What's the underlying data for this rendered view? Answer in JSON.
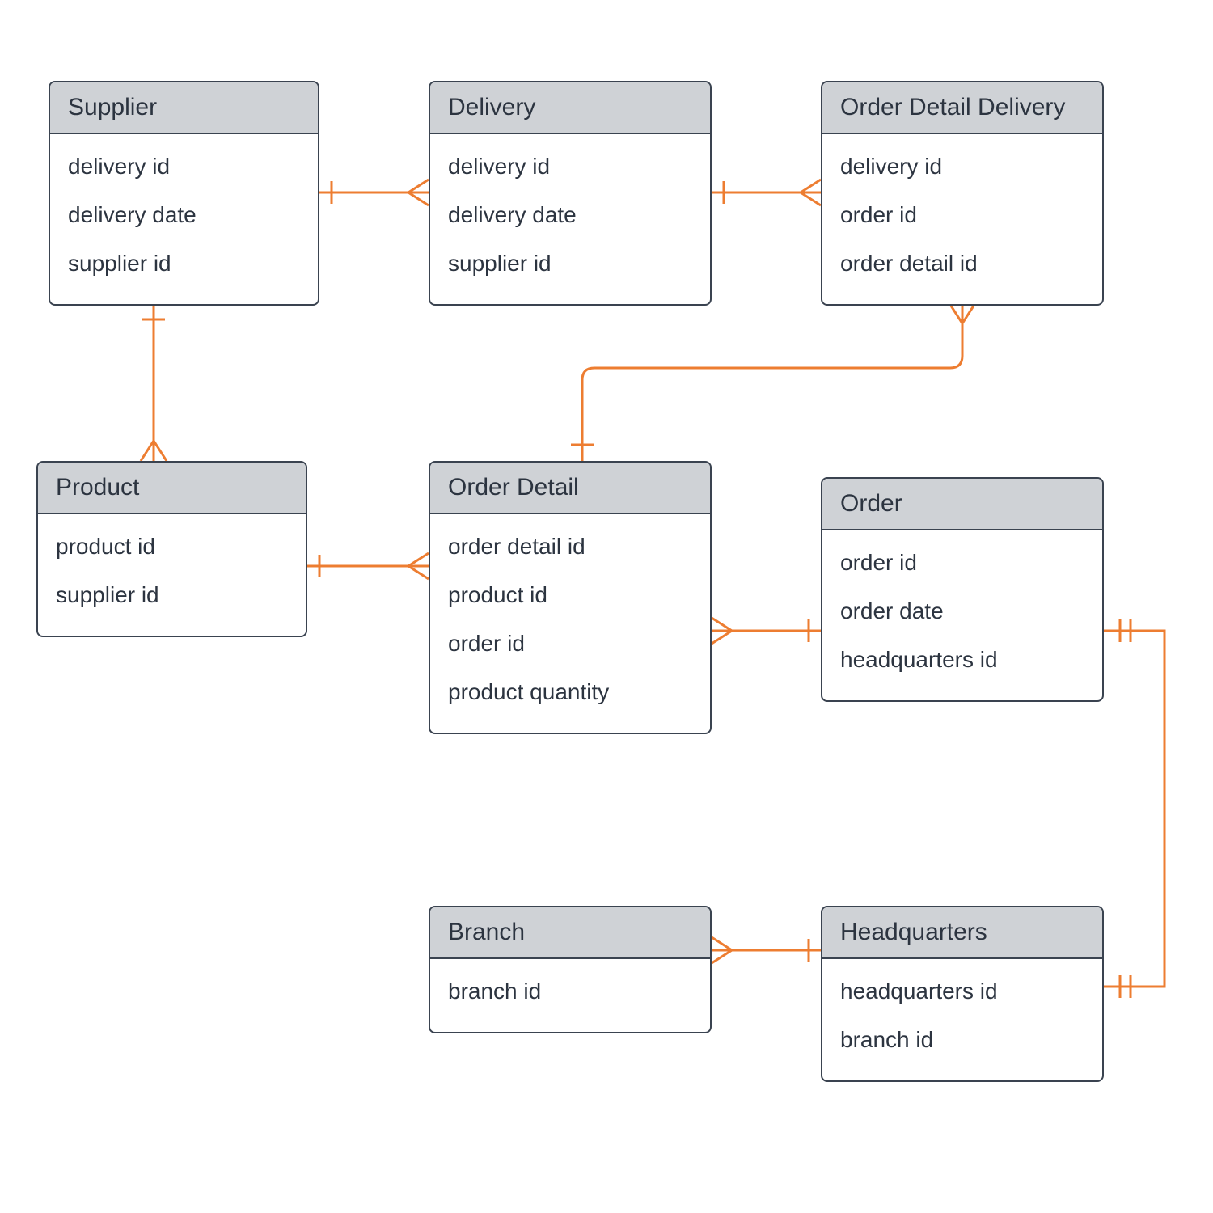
{
  "entities": {
    "supplier": {
      "title": "Supplier",
      "attrs": [
        "delivery id",
        "delivery date",
        "supplier id"
      ]
    },
    "delivery": {
      "title": "Delivery",
      "attrs": [
        "delivery id",
        "delivery date",
        "supplier id"
      ]
    },
    "orderDetailDelivery": {
      "title": "Order Detail Delivery",
      "attrs": [
        "delivery id",
        "order id",
        "order detail id"
      ]
    },
    "product": {
      "title": "Product",
      "attrs": [
        "product id",
        "supplier id"
      ]
    },
    "orderDetail": {
      "title": "Order Detail",
      "attrs": [
        "order detail id",
        "product id",
        "order id",
        "product quantity"
      ]
    },
    "order": {
      "title": "Order",
      "attrs": [
        "order id",
        "order date",
        "headquarters id"
      ]
    },
    "branch": {
      "title": "Branch",
      "attrs": [
        "branch id"
      ]
    },
    "headquarters": {
      "title": "Headquarters",
      "attrs": [
        "headquarters id",
        "branch id"
      ]
    }
  },
  "colors": {
    "connector": "#ed7d31",
    "border": "#3a4350",
    "header": "#cfd2d6"
  }
}
